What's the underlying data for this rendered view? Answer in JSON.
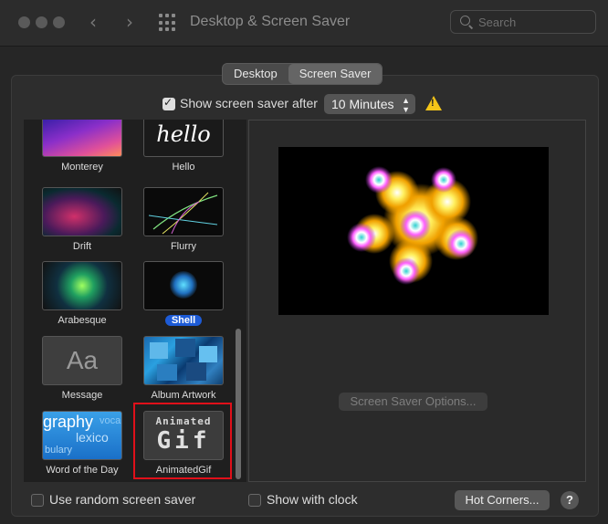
{
  "window": {
    "title": "Desktop & Screen Saver"
  },
  "search": {
    "placeholder": "Search"
  },
  "tabs": [
    {
      "label": "Desktop"
    },
    {
      "label": "Screen Saver"
    }
  ],
  "options": {
    "show_after_label": "Show screen saver after",
    "show_after_value": "10 Minutes",
    "random_label": "Use random screen saver",
    "clock_label": "Show with clock"
  },
  "savers": [
    {
      "name": "Monterey"
    },
    {
      "name": "Hello",
      "thumb_text": "hello"
    },
    {
      "name": "Drift"
    },
    {
      "name": "Flurry"
    },
    {
      "name": "Arabesque"
    },
    {
      "name": "Shell",
      "selected": true
    },
    {
      "name": "Message",
      "thumb_text": "Aa"
    },
    {
      "name": "Album Artwork"
    },
    {
      "name": "Word of the Day",
      "thumb_text": "graphy",
      "thumb_text2": "lexico",
      "thumb_text3": "bulary",
      "thumb_text4": "voca"
    },
    {
      "name": "AnimatedGif",
      "thumb_text": "Animated",
      "thumb_text2": "Gif"
    }
  ],
  "buttons": {
    "options": "Screen Saver Options...",
    "hot_corners": "Hot Corners...",
    "help": "?"
  },
  "colors": {
    "accent": "#1d5bd6",
    "warning": "#f5c518",
    "highlight_box": "#e0101a"
  }
}
